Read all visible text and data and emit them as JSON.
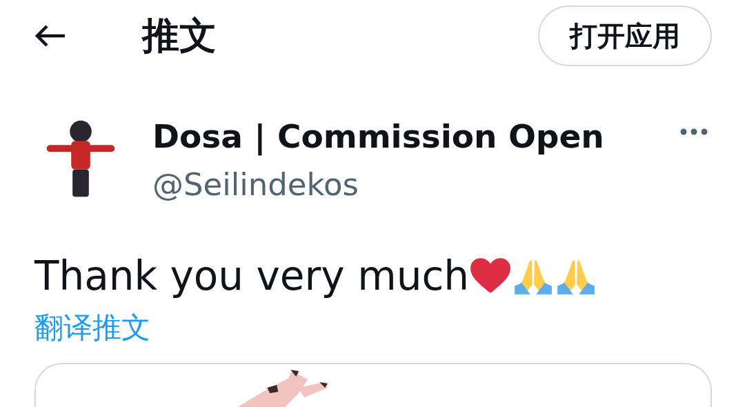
{
  "header": {
    "title": "推文",
    "open_app_button": "打开应用"
  },
  "tweet": {
    "author": {
      "name": "Dosa | Commission Open",
      "handle": "@Seilindekos"
    },
    "text": "Thank you very much",
    "emoji": [
      {
        "kind": "heart"
      },
      {
        "kind": "praying-hands"
      },
      {
        "kind": "praying-hands"
      }
    ],
    "translate_link": "翻译推文"
  }
}
